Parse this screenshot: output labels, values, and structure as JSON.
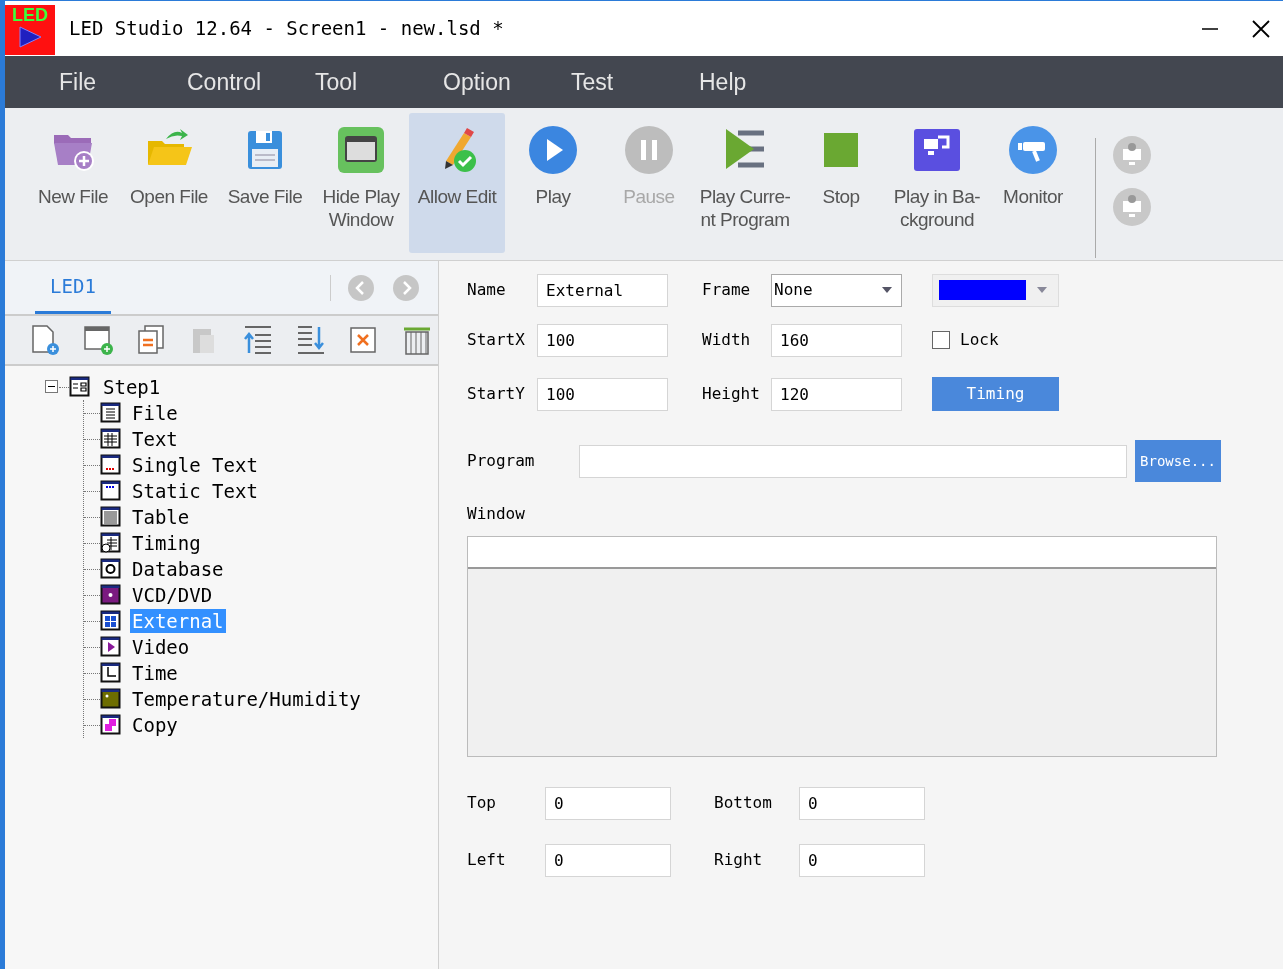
{
  "window": {
    "logo_text": "LED",
    "title": "LED Studio 12.64 - Screen1 - new.lsd *"
  },
  "menu": [
    "File",
    "Control",
    "Tool",
    "Option",
    "Test",
    "Help"
  ],
  "toolbar": [
    {
      "kind": "new-file",
      "label": "New File",
      "selected": false,
      "disabled": false
    },
    {
      "kind": "open-file",
      "label": "Open File",
      "selected": false,
      "disabled": false
    },
    {
      "kind": "save-file",
      "label": "Save File",
      "selected": false,
      "disabled": false
    },
    {
      "kind": "hide-window",
      "label": "Hide Play Window",
      "selected": false,
      "disabled": false
    },
    {
      "kind": "allow-edit",
      "label": "Allow Edit",
      "selected": true,
      "disabled": false
    },
    {
      "kind": "play",
      "label": "Play",
      "selected": false,
      "disabled": false
    },
    {
      "kind": "pause",
      "label": "Pause",
      "selected": false,
      "disabled": true
    },
    {
      "kind": "play-current",
      "label": "Play Curre-nt Program",
      "selected": false,
      "disabled": false
    },
    {
      "kind": "stop",
      "label": "Stop",
      "selected": false,
      "disabled": false
    },
    {
      "kind": "play-background",
      "label": "Play in Ba-ckground",
      "selected": false,
      "disabled": false
    },
    {
      "kind": "monitor",
      "label": "Monitor",
      "selected": false,
      "disabled": false
    }
  ],
  "screen_tab": {
    "label": "LED1",
    "selected": true
  },
  "tree_tools": [
    {
      "kind": "add-page",
      "disabled": false
    },
    {
      "kind": "add-window",
      "disabled": false
    },
    {
      "kind": "copy",
      "disabled": false
    },
    {
      "kind": "paste",
      "disabled": true
    },
    {
      "kind": "move-up",
      "disabled": false
    },
    {
      "kind": "move-down",
      "disabled": false
    },
    {
      "kind": "delete",
      "disabled": false
    },
    {
      "kind": "trash",
      "disabled": false
    }
  ],
  "tree": [
    {
      "label": "Step1",
      "kind": "step",
      "expanded": true,
      "selected": false,
      "children": [
        {
          "label": "File",
          "kind": "file",
          "selected": false
        },
        {
          "label": "Text",
          "kind": "text",
          "selected": false
        },
        {
          "label": "Single Text",
          "kind": "single-text",
          "selected": false
        },
        {
          "label": "Static Text",
          "kind": "static-text",
          "selected": false
        },
        {
          "label": "Table",
          "kind": "table",
          "selected": false
        },
        {
          "label": "Timing",
          "kind": "timing",
          "selected": false
        },
        {
          "label": "Database",
          "kind": "database",
          "selected": false
        },
        {
          "label": "VCD/DVD",
          "kind": "dvd",
          "selected": false
        },
        {
          "label": "External",
          "kind": "external",
          "selected": true
        },
        {
          "label": "Video",
          "kind": "video",
          "selected": false
        },
        {
          "label": "Time",
          "kind": "time",
          "selected": false
        },
        {
          "label": "Temperature/Humidity",
          "kind": "temperature",
          "selected": false
        },
        {
          "label": "Copy",
          "kind": "copy",
          "selected": false
        }
      ]
    }
  ],
  "form": {
    "name": {
      "label": "Name",
      "value": "External"
    },
    "frame": {
      "label": "Frame",
      "value": "None"
    },
    "color": "#0000ff",
    "startx": {
      "label": "StartX",
      "value": "100"
    },
    "width": {
      "label": "Width",
      "value": "160"
    },
    "lock": {
      "label": "Lock",
      "checked": false
    },
    "starty": {
      "label": "StartY",
      "value": "100"
    },
    "height": {
      "label": "Height",
      "value": "120"
    },
    "timing_button": "Timing",
    "program": {
      "label": "Program"
    },
    "browse_button": "Browse...",
    "window_label": "Window",
    "top": {
      "label": "Top",
      "value": "0"
    },
    "bottom": {
      "label": "Bottom",
      "value": "0"
    },
    "left": {
      "label": "Left",
      "value": "0"
    },
    "right": {
      "label": "Right",
      "value": "0"
    }
  }
}
